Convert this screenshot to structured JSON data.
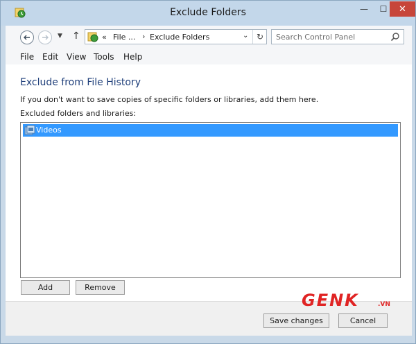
{
  "window": {
    "title": "Exclude Folders",
    "minimize_glyph": "—",
    "maximize_glyph": "☐",
    "close_glyph": "✕"
  },
  "nav": {
    "back_icon": "back-arrow-icon",
    "forward_icon": "forward-arrow-icon",
    "up_glyph": "↑",
    "breadcrumb_prefix": "«",
    "breadcrumb": [
      "File ...",
      "Exclude Folders"
    ],
    "refresh_glyph": "↻",
    "dropdown_glyph": "⌄"
  },
  "search": {
    "placeholder": "Search Control Panel"
  },
  "menu": [
    "File",
    "Edit",
    "View",
    "Tools",
    "Help"
  ],
  "content": {
    "title": "Exclude from File History",
    "description": "If you don't want to save copies of specific folders or libraries, add them here.",
    "list_label": "Excluded folders and libraries:",
    "items": [
      {
        "label": "Videos",
        "icon": "library-icon",
        "selected": true
      }
    ]
  },
  "buttons": {
    "add": "Add",
    "remove": "Remove",
    "save": "Save changes",
    "cancel": "Cancel"
  },
  "watermark": {
    "text": "GENK",
    "suffix": ".VN",
    "color": "#e02424"
  },
  "colors": {
    "selection": "#3399ff",
    "title_blue": "#1f3f7a",
    "close_red": "#c7463a"
  }
}
